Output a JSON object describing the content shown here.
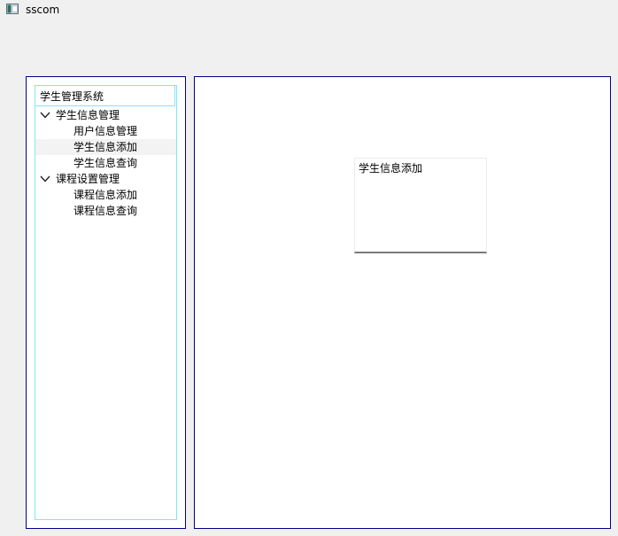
{
  "window": {
    "title": "sscom",
    "icon": "app-window-icon"
  },
  "tree": {
    "header": "学生管理系统",
    "groups": [
      {
        "label": "学生信息管理",
        "expanded": true,
        "items": [
          {
            "label": "用户信息管理"
          },
          {
            "label": "学生信息添加",
            "selected": true
          },
          {
            "label": "学生信息查询"
          }
        ]
      },
      {
        "label": "课程设置管理",
        "expanded": true,
        "items": [
          {
            "label": "课程信息添加"
          },
          {
            "label": "课程信息查询"
          }
        ]
      }
    ]
  },
  "content": {
    "label": "学生信息添加"
  },
  "colors": {
    "panel_border": "#00008b",
    "tree_border": "#7fe8f0",
    "selected_row": "#f3f3f3",
    "window_bg": "#f0f0f0"
  }
}
